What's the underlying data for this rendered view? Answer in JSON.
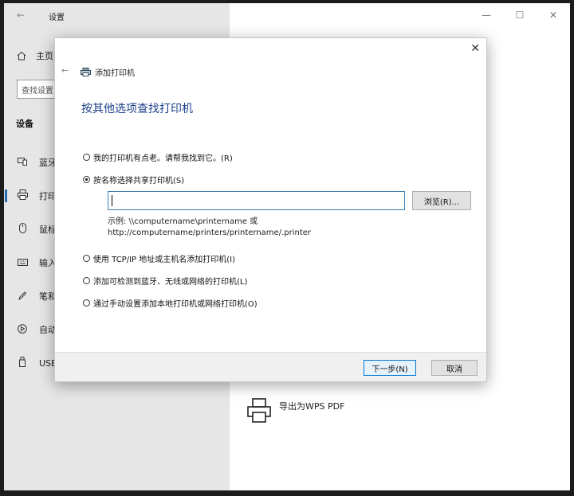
{
  "settings": {
    "back_icon": "back-arrow-icon",
    "title": "设置",
    "controls": {
      "minimize": "—",
      "maximize": "☐",
      "close": "✕"
    },
    "home_label": "主页",
    "search_placeholder": "查找设置",
    "section_title": "设备",
    "nav": [
      {
        "label": "蓝牙和其他设备",
        "icon": "bluetooth-devices-icon"
      },
      {
        "label": "打印机和扫描仪",
        "icon": "printer-icon",
        "active": true
      },
      {
        "label": "鼠标",
        "icon": "mouse-icon"
      },
      {
        "label": "输入",
        "icon": "keyboard-icon"
      },
      {
        "label": "笔和 Windows Ink",
        "icon": "pen-icon"
      },
      {
        "label": "自动播放",
        "icon": "autoplay-icon"
      },
      {
        "label": "USB",
        "icon": "usb-icon"
      }
    ],
    "printer_entry": "导出为WPS PDF"
  },
  "dialog": {
    "close": "✕",
    "title": "添加打印机",
    "heading": "按其他选项查找打印机",
    "options": [
      {
        "label": "我的打印机有点老。请帮我找到它。(R)",
        "checked": false
      },
      {
        "label": "按名称选择共享打印机(S)",
        "checked": true
      },
      {
        "label": "使用 TCP/IP 地址或主机名添加打印机(I)",
        "checked": false
      },
      {
        "label": "添加可检测到蓝牙、无线或网络的打印机(L)",
        "checked": false
      },
      {
        "label": "通过手动设置添加本地打印机或网络打印机(O)",
        "checked": false
      }
    ],
    "input_value": "",
    "browse_label": "浏览(R)...",
    "example_line1": "示例: \\\\computername\\printername 或",
    "example_line2": "http://computername/printers/printername/.printer",
    "next_label": "下一步(N)",
    "cancel_label": "取消"
  }
}
